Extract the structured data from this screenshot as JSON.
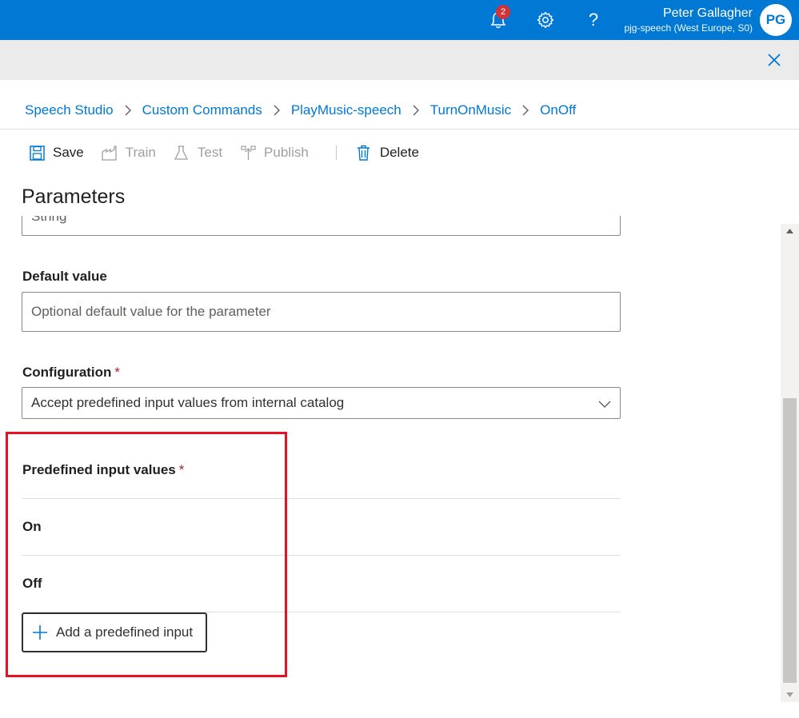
{
  "header": {
    "notifications_count": "2",
    "user_name": "Peter Gallagher",
    "user_resource": "pjg-speech (West Europe, S0)",
    "avatar_initials": "PG",
    "help_glyph": "?",
    "icons": [
      "bell-icon",
      "gear-icon",
      "help-icon",
      "close-icon"
    ],
    "accent_color": "#0078d4"
  },
  "breadcrumb": [
    "Speech Studio",
    "Custom Commands",
    "PlayMusic-speech",
    "TurnOnMusic",
    "OnOff"
  ],
  "toolbar": {
    "save": "Save",
    "train": "Train",
    "test": "Test",
    "publish": "Publish",
    "delete": "Delete"
  },
  "panel": {
    "title": "Parameters",
    "type_field_value": "String",
    "default_value": {
      "label": "Default value",
      "placeholder": "Optional default value for the parameter"
    },
    "configuration": {
      "label": "Configuration",
      "required_mark": "*",
      "selected": "Accept predefined input values from internal catalog"
    },
    "predefined": {
      "label": "Predefined input values",
      "required_mark": "*",
      "values": [
        "On",
        "Off"
      ],
      "add_button": "Add a predefined input"
    }
  },
  "highlight_color": "#e81123"
}
